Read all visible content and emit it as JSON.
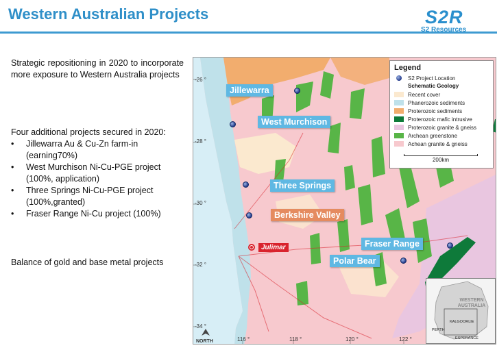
{
  "slide": {
    "title": "Western Australian Projects",
    "logo_mark": "S2R",
    "logo_sub": "S2 Resources"
  },
  "content": {
    "intro": "Strategic repositioning in 2020 to incorporate more exposure to Western Australia projects",
    "projects_heading": "Four additional projects secured in 2020:",
    "bullet_glyph": "•",
    "projects": [
      {
        "line1": "Jillewarra Au & Cu-Zn farm-in",
        "line2": "(earning70%)"
      },
      {
        "line1": "West Murchison Ni-Cu-PGE  project",
        "line2": "(100%, application)"
      },
      {
        "line1": "Three Springs Ni-Cu-PGE project",
        "line2": "(100%,granted)"
      },
      {
        "line1": "Fraser Range Ni-Cu project (100%)",
        "line2": ""
      }
    ],
    "balance": "Balance of gold and base metal projects"
  },
  "map": {
    "colors": {
      "sea": "#d7eef6",
      "recent_cover": "#fbe9cf",
      "phanerozoic": "#bfe1ea",
      "proterozoic_sed": "#f2ad6e",
      "proterozoic_mafic": "#0e7a3a",
      "proterozoic_granite": "#e9c6e0",
      "archean_greenstone": "#58b547",
      "archean_granite": "#f7c9ce"
    },
    "project_labels": {
      "jillewarra": "Jillewarra",
      "west_murchison": "West Murchison",
      "three_springs": "Three Springs",
      "berkshire_valley": "Berkshire Valley",
      "fraser_range": "Fraser Range",
      "polar_bear": "Polar Bear",
      "julimar": "Julimar"
    },
    "latitudes": [
      "-26 °",
      "-28 °",
      "-30 °",
      "-32 °",
      "-34 °"
    ],
    "longitudes": [
      "116 °",
      "118 °",
      "120 °",
      "122 °"
    ],
    "north_label": "NORTH",
    "legend": {
      "title": "Legend",
      "project_location": "S2 Project Location",
      "subheading": "Schematic Geology",
      "items": [
        {
          "label": "Recent cover",
          "color": "#fbe9cf"
        },
        {
          "label": "Phanerozoic sediments",
          "color": "#bfe1ea"
        },
        {
          "label": "Proterozoic sediments",
          "color": "#f2ad6e"
        },
        {
          "label": "Proterozoic mafic intrusive",
          "color": "#0e7a3a"
        },
        {
          "label": "Proterozoic granite & gneiss",
          "color": "#e9c6e0"
        },
        {
          "label": "Archean greenstone",
          "color": "#58b547"
        },
        {
          "label": "Achean granite & gneiss",
          "color": "#f7c9ce"
        }
      ],
      "scale": "200km"
    },
    "inset": {
      "region": "WESTERN AUSTRALIA",
      "towns": [
        "KALGOORLIE",
        "PERTH",
        "ESPERANCE"
      ]
    }
  }
}
